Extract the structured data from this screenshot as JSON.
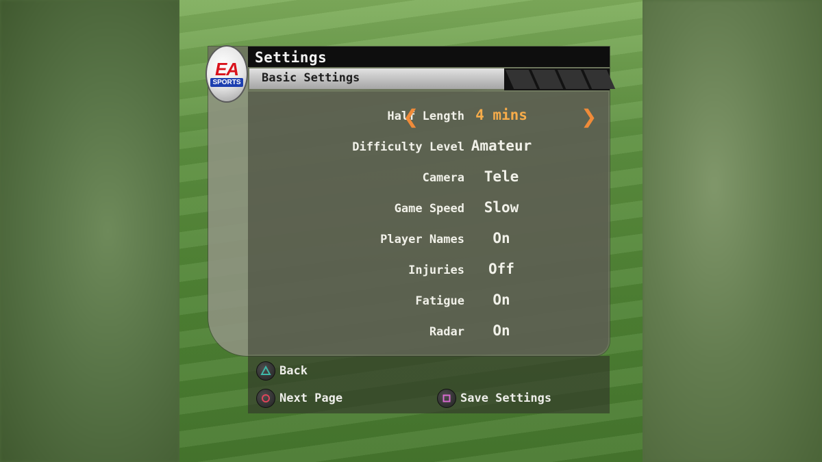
{
  "header": {
    "title": "Settings",
    "subtitle": "Basic Settings"
  },
  "logo": {
    "ea_text": "EA",
    "sports_text": "SPORTS"
  },
  "settings": [
    {
      "label": "Half Length",
      "value": "4 mins",
      "selected": true
    },
    {
      "label": "Difficulty Level",
      "value": "Amateur",
      "selected": false
    },
    {
      "label": "Camera",
      "value": "Tele",
      "selected": false
    },
    {
      "label": "Game Speed",
      "value": "Slow",
      "selected": false
    },
    {
      "label": "Player Names",
      "value": "On",
      "selected": false
    },
    {
      "label": "Injuries",
      "value": "Off",
      "selected": false
    },
    {
      "label": "Fatigue",
      "value": "On",
      "selected": false
    },
    {
      "label": "Radar",
      "value": "On",
      "selected": false
    }
  ],
  "arrows": {
    "left_icon": "chevron-left-icon",
    "right_icon": "chevron-right-icon"
  },
  "footer": {
    "back": {
      "label": "Back",
      "icon": "triangle-button-icon",
      "color": "#3fb7a8"
    },
    "next_page": {
      "label": "Next Page",
      "icon": "circle-button-icon",
      "color": "#e0445a"
    },
    "save": {
      "label": "Save Settings",
      "icon": "square-button-icon",
      "color": "#d86ad0"
    }
  },
  "colors": {
    "selected_value": "#f7ac4a",
    "arrow": "#f08b39",
    "title_bar": "#0e0e0e"
  }
}
